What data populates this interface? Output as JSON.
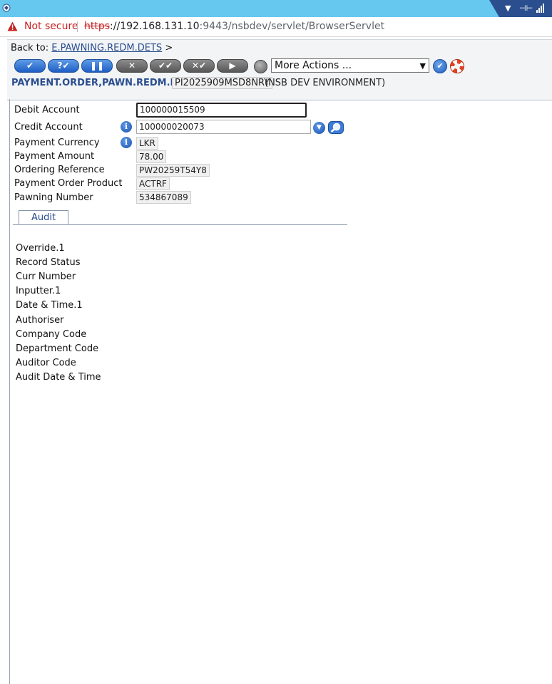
{
  "browser": {
    "security_label": "Not secure",
    "url_protocol": "https",
    "url_host": "://192.168.131.10",
    "url_rest": ":9443/nsbdev/servlet/BrowserServlet"
  },
  "header": {
    "back_to_label": "Back to:",
    "back_to_link": "E.PAWNING.REDM.DETS",
    "back_to_arrow": ">",
    "more_actions": "More Actions ...",
    "application": "PAYMENT.ORDER,PAWN.REDM.NSB",
    "record_id": "PI2025909MSD8NRY",
    "environment": "(NSB DEV ENVIRONMENT)"
  },
  "form": {
    "debit_account": {
      "label": "Debit Account",
      "value": "100000015509"
    },
    "credit_account": {
      "label": "Credit Account",
      "value": "100000020073"
    },
    "payment_currency": {
      "label": "Payment Currency",
      "value": "LKR"
    },
    "payment_amount": {
      "label": "Payment Amount",
      "value": "78.00"
    },
    "ordering_reference": {
      "label": "Ordering Reference",
      "value": "PW20259T54Y8"
    },
    "payment_order_product": {
      "label": "Payment Order Product",
      "value": "ACTRF"
    },
    "pawning_number": {
      "label": "Pawning Number",
      "value": "534867089"
    }
  },
  "tabs": [
    {
      "label": "Audit"
    }
  ],
  "audit_fields": [
    "Override.1",
    "Record Status",
    "Curr Number",
    "Inputter.1",
    "Date & Time.1",
    "Authoriser",
    "Company Code",
    "Department Code",
    "Auditor Code",
    "Audit Date & Time"
  ],
  "colors": {
    "accent": "#2a4d8f",
    "title_strip": "#66c8ef",
    "tray": "#2b4f8e",
    "warning": "#c5221f"
  }
}
